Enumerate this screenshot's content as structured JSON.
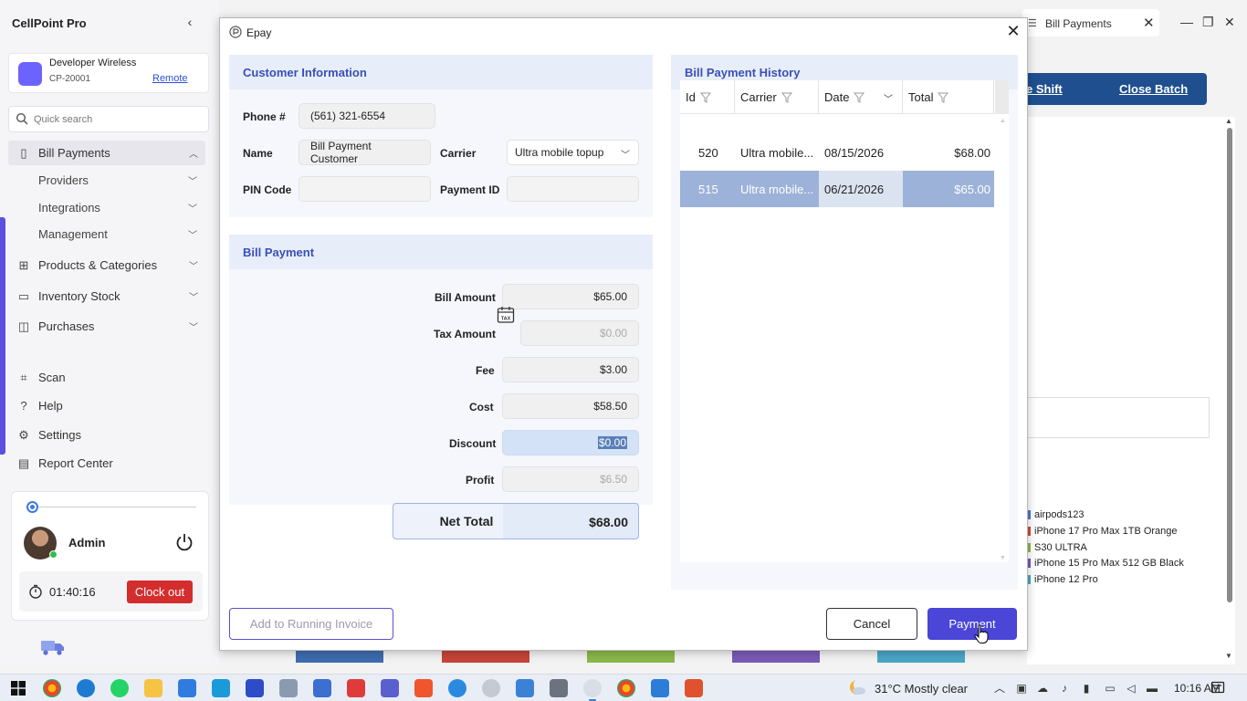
{
  "app": {
    "title": "CellPoint Pro"
  },
  "store": {
    "name": "Developer Wireless",
    "id": "CP-20001",
    "remote_label": "Remote"
  },
  "search": {
    "placeholder": "Quick search"
  },
  "nav": {
    "bill_payments": "Bill Payments",
    "sub": [
      "Providers",
      "Integrations",
      "Management"
    ],
    "products": "Products & Categories",
    "inventory": "Inventory Stock",
    "purchases": "Purchases",
    "scan": "Scan",
    "help": "Help",
    "settings": "Settings",
    "report": "Report Center"
  },
  "user": {
    "name": "Admin",
    "timer": "01:40:16",
    "clockout_label": "Clock out"
  },
  "background": {
    "tab_label": "Bill Payments",
    "toolbar": {
      "shift_label": "e Shift",
      "close_batch_label": "Close Batch"
    },
    "legend": [
      {
        "label": "airpods123",
        "color": "#4a78c8"
      },
      {
        "label": "iPhone 17 Pro Max 1TB Orange",
        "color": "#d04a3a"
      },
      {
        "label": "S30 ULTRA",
        "color": "#8cb84a"
      },
      {
        "label": "iPhone 15 Pro Max 512 GB Black",
        "color": "#7a5ab8"
      },
      {
        "label": "iPhone 12 Pro",
        "color": "#4aa6c8"
      }
    ]
  },
  "dialog": {
    "title": "Epay",
    "customer": {
      "heading": "Customer Information",
      "phone_label": "Phone #",
      "phone_value": "(561) 321-6554",
      "name_label": "Name",
      "name_value": "Bill Payment Customer",
      "carrier_label": "Carrier",
      "carrier_value": "Ultra mobile topup",
      "pin_label": "PIN Code",
      "pin_value": "",
      "payment_id_label": "Payment ID",
      "payment_id_value": ""
    },
    "bill": {
      "heading": "Bill Payment",
      "bill_amount_label": "Bill Amount",
      "bill_amount_value": "$65.00",
      "tax_label": "Tax Amount",
      "tax_value": "$0.00",
      "fee_label": "Fee",
      "fee_value": "$3.00",
      "cost_label": "Cost",
      "cost_value": "$58.50",
      "discount_label": "Discount",
      "discount_value": "$0.00",
      "profit_label": "Profit",
      "profit_value": "$6.50",
      "net_total_label": "Net Total",
      "net_total_value": "$68.00"
    },
    "history": {
      "heading": "Bill Payment History",
      "columns": [
        "Id",
        "Carrier",
        "Date",
        "Total"
      ],
      "rows": [
        {
          "id": "520",
          "carrier": "Ultra mobile...",
          "date": "08/15/2026",
          "total": "$68.00"
        },
        {
          "id": "515",
          "carrier": "Ultra mobile...",
          "date": "06/21/2026",
          "total": "$65.00"
        }
      ]
    },
    "buttons": {
      "add_running": "Add to Running Invoice",
      "cancel": "Cancel",
      "payment": "Payment"
    }
  },
  "taskbar": {
    "weather": "31°C  Mostly clear",
    "time": "10:16 AM"
  }
}
